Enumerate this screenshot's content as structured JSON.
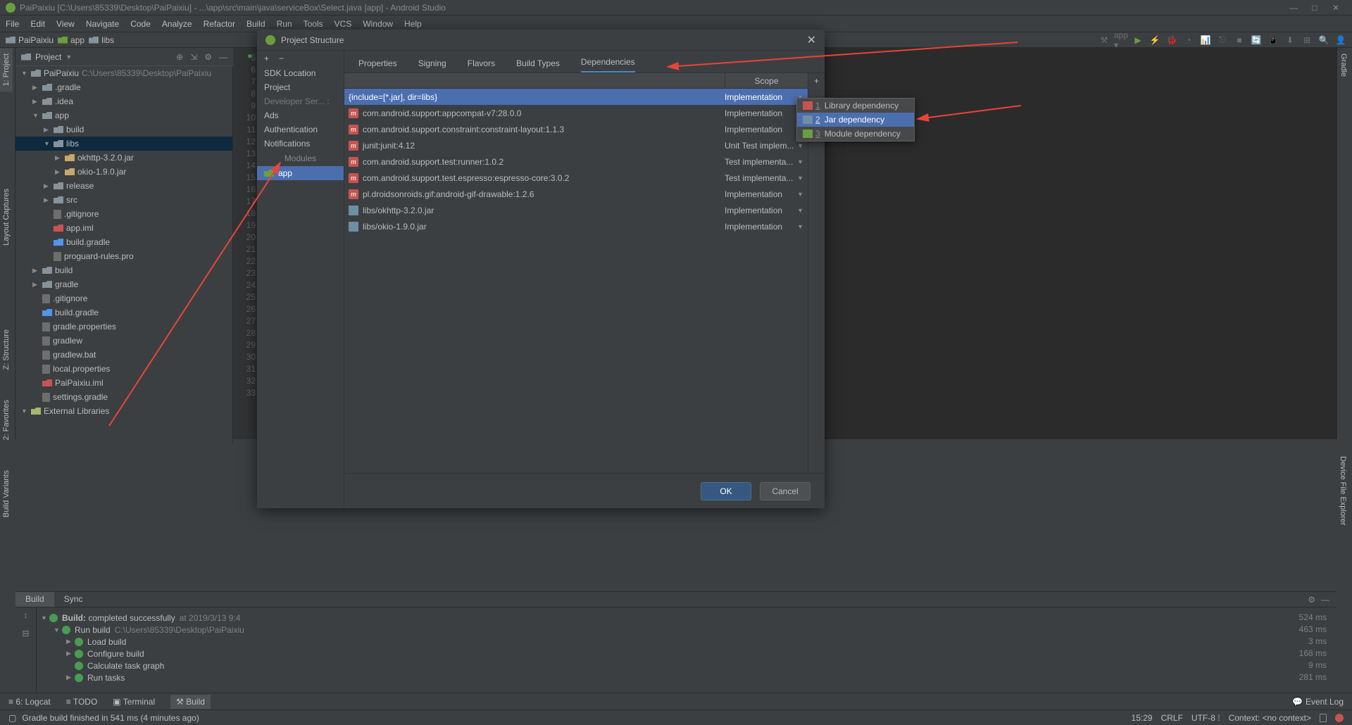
{
  "titlebar": {
    "title": "PaiPaixiu [C:\\Users\\85339\\Desktop\\PaiPaixiu] - ...\\app\\src\\main\\java\\serviceBox\\Select.java [app] - Android Studio"
  },
  "menubar": [
    "File",
    "Edit",
    "View",
    "Navigate",
    "Code",
    "Analyze",
    "Refactor",
    "Build",
    "Run",
    "Tools",
    "VCS",
    "Window",
    "Help"
  ],
  "breadcrumb": [
    "PaiPaixiu",
    "app",
    "libs"
  ],
  "proj_header": {
    "label": "Project"
  },
  "tree": [
    {
      "ind": 0,
      "arrow": "▼",
      "icon": "folder",
      "text": "PaiPaixiu",
      "suffix": " C:\\Users\\85339\\Desktop\\PaiPaixiu"
    },
    {
      "ind": 1,
      "arrow": "▶",
      "icon": "folder",
      "text": ".gradle"
    },
    {
      "ind": 1,
      "arrow": "▶",
      "icon": "folder",
      "text": ".idea"
    },
    {
      "ind": 1,
      "arrow": "▼",
      "icon": "folder",
      "text": "app"
    },
    {
      "ind": 2,
      "arrow": "▶",
      "icon": "folder",
      "text": "build"
    },
    {
      "ind": 2,
      "arrow": "▼",
      "icon": "folder",
      "text": "libs",
      "sel": true
    },
    {
      "ind": 3,
      "arrow": "▶",
      "icon": "jar",
      "text": "okhttp-3.2.0.jar"
    },
    {
      "ind": 3,
      "arrow": "▶",
      "icon": "jar",
      "text": "okio-1.9.0.jar"
    },
    {
      "ind": 2,
      "arrow": "▶",
      "icon": "folder",
      "text": "release"
    },
    {
      "ind": 2,
      "arrow": "▶",
      "icon": "folder",
      "text": "src"
    },
    {
      "ind": 2,
      "arrow": "",
      "icon": "file",
      "text": ".gitignore"
    },
    {
      "ind": 2,
      "arrow": "",
      "icon": "iml",
      "text": "app.iml"
    },
    {
      "ind": 2,
      "arrow": "",
      "icon": "gradle",
      "text": "build.gradle"
    },
    {
      "ind": 2,
      "arrow": "",
      "icon": "file",
      "text": "proguard-rules.pro"
    },
    {
      "ind": 1,
      "arrow": "▶",
      "icon": "folder",
      "text": "build"
    },
    {
      "ind": 1,
      "arrow": "▶",
      "icon": "folder",
      "text": "gradle"
    },
    {
      "ind": 1,
      "arrow": "",
      "icon": "file",
      "text": ".gitignore"
    },
    {
      "ind": 1,
      "arrow": "",
      "icon": "gradle",
      "text": "build.gradle"
    },
    {
      "ind": 1,
      "arrow": "",
      "icon": "file",
      "text": "gradle.properties"
    },
    {
      "ind": 1,
      "arrow": "",
      "icon": "file",
      "text": "gradlew"
    },
    {
      "ind": 1,
      "arrow": "",
      "icon": "file",
      "text": "gradlew.bat"
    },
    {
      "ind": 1,
      "arrow": "",
      "icon": "file",
      "text": "local.properties"
    },
    {
      "ind": 1,
      "arrow": "",
      "icon": "iml",
      "text": "PaiPaixiu.iml"
    },
    {
      "ind": 1,
      "arrow": "",
      "icon": "file",
      "text": "settings.gradle"
    },
    {
      "ind": 0,
      "arrow": "▼",
      "icon": "lib",
      "text": "External Libraries"
    }
  ],
  "gutter_lines": [
    "5",
    "6",
    "7",
    "8",
    "9",
    "10",
    "11",
    "12",
    "13",
    "14",
    "15",
    "16",
    "17",
    "18",
    "19",
    "20",
    "21",
    "22",
    "23",
    "24",
    "25",
    "26",
    "27",
    "28",
    "29",
    "30",
    "31",
    "32",
    "33"
  ],
  "left_tabs": [
    "1: Project",
    "2: Favorites",
    "Z: Structure",
    "Layout Captures",
    "Build Variants"
  ],
  "right_tabs": [
    "Gradle",
    "Device File Explorer"
  ],
  "build": {
    "tabs": [
      "Build",
      "Sync"
    ],
    "rows": [
      {
        "ind": 0,
        "arrow": "▼",
        "text": "Build: ",
        "bold": "completed successfully",
        "dim": " at 2019/3/13 9:4",
        "time": "524 ms"
      },
      {
        "ind": 1,
        "arrow": "▼",
        "text": "Run build",
        "dim": " C:\\Users\\85339\\Desktop\\PaiPaixiu",
        "time": "463 ms"
      },
      {
        "ind": 2,
        "arrow": "▶",
        "text": "Load build",
        "time": "3 ms"
      },
      {
        "ind": 2,
        "arrow": "▶",
        "text": "Configure build",
        "time": "168 ms"
      },
      {
        "ind": 2,
        "arrow": "",
        "text": "Calculate task graph",
        "time": "9 ms"
      },
      {
        "ind": 2,
        "arrow": "▶",
        "text": "Run tasks",
        "time": "281 ms"
      }
    ]
  },
  "bottom_tools": [
    "6: Logcat",
    "TODO",
    "Terminal",
    "Build"
  ],
  "event_log": "Event Log",
  "statusbar": {
    "msg": "Gradle build finished in 541 ms (4 minutes ago)",
    "pos": "15:29",
    "crlf": "CRLF",
    "enc": "UTF-8",
    "ctx": "Context: <no context>"
  },
  "dialog": {
    "title": "Project Structure",
    "cats": [
      "SDK Location",
      "Project",
      "Developer Ser... :",
      "Ads",
      "Authentication",
      "Notifications"
    ],
    "mod_hdr": "Modules",
    "mod_item": "app",
    "tabs": [
      "Properties",
      "Signing",
      "Flavors",
      "Build Types",
      "Dependencies"
    ],
    "scope_hdr": "Scope",
    "deps": [
      {
        "icon": "",
        "name": "{include=[*.jar], dir=libs}",
        "scope": "Implementation",
        "sel": true
      },
      {
        "icon": "m",
        "name": "com.android.support:appcompat-v7:28.0.0",
        "scope": "Implementation"
      },
      {
        "icon": "m",
        "name": "com.android.support.constraint:constraint-layout:1.1.3",
        "scope": "Implementation"
      },
      {
        "icon": "m",
        "name": "junit:junit:4.12",
        "scope": "Unit Test implem..."
      },
      {
        "icon": "m",
        "name": "com.android.support.test:runner:1.0.2",
        "scope": "Test implementa..."
      },
      {
        "icon": "m",
        "name": "com.android.support.test.espresso:espresso-core:3.0.2",
        "scope": "Test implementa..."
      },
      {
        "icon": "m",
        "name": "pl.droidsonroids.gif:android-gif-drawable:1.2.6",
        "scope": "Implementation"
      },
      {
        "icon": "l",
        "name": "libs/okhttp-3.2.0.jar",
        "scope": "Implementation"
      },
      {
        "icon": "l",
        "name": "libs/okio-1.9.0.jar",
        "scope": "Implementation"
      }
    ],
    "ok": "OK",
    "cancel": "Cancel"
  },
  "popup": [
    {
      "num": "1",
      "icon": "m",
      "label": "Library dependency"
    },
    {
      "num": "2",
      "icon": "f",
      "label": "Jar dependency",
      "sel": true
    },
    {
      "num": "3",
      "icon": "g",
      "label": "Module dependency"
    }
  ]
}
